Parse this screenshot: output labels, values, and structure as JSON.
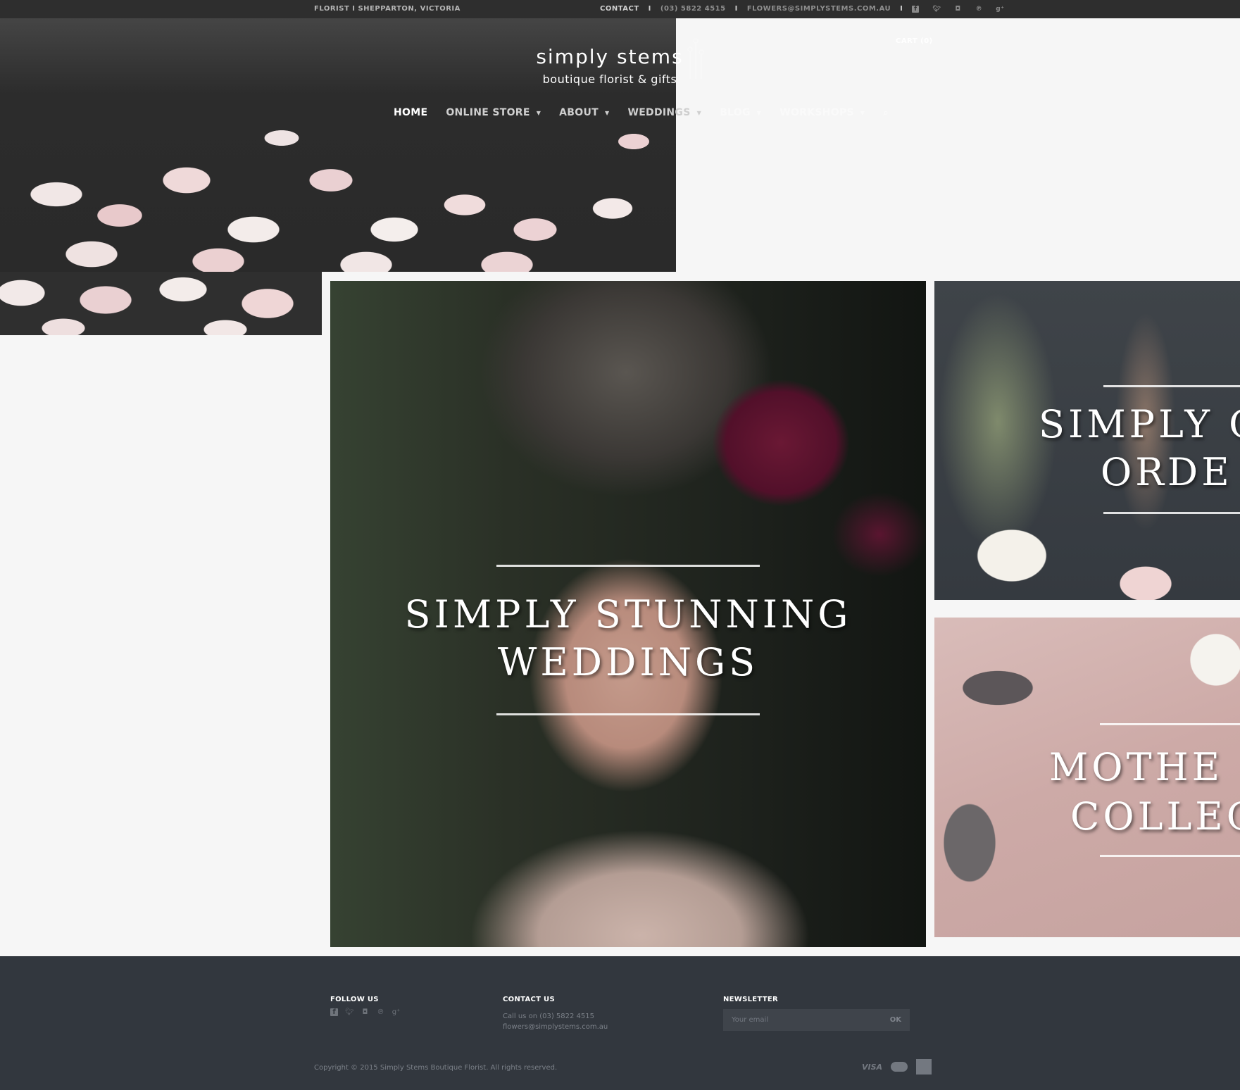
{
  "topbar": {
    "location": "FLORIST I SHEPPARTON, VICTORIA",
    "contact_label": "CONTACT",
    "separator": "I",
    "phone": "(03) 5822 4515",
    "email": "FLOWERS@SIMPLYSTEMS.COM.AU",
    "social_icons": [
      "facebook-icon",
      "twitter-icon",
      "instagram-icon",
      "pinterest-icon",
      "google-plus-icon"
    ]
  },
  "header": {
    "logo_name": "simply stems",
    "logo_tagline": "boutique florist & gifts",
    "cart_label": "CART (0)"
  },
  "nav": {
    "items": [
      {
        "label": "HOME",
        "active": true,
        "dropdown": false
      },
      {
        "label": "ONLINE STORE",
        "active": false,
        "dropdown": true
      },
      {
        "label": "ABOUT",
        "active": false,
        "dropdown": true
      },
      {
        "label": "WEDDINGS",
        "active": false,
        "dropdown": true
      },
      {
        "label": "BLOG",
        "active": false,
        "dropdown": true
      },
      {
        "label": "WORKSHOPS",
        "active": false,
        "dropdown": true
      }
    ],
    "caret": "▼",
    "search_icon": "⌕"
  },
  "promos": {
    "weddings": {
      "line1": "SIMPLY STUNNING",
      "line2": "WEDDINGS"
    },
    "order": {
      "line1": "SIMPLY O",
      "line2": "ORDE"
    },
    "mothers": {
      "line1": "MOTHE",
      "line2": "COLLEC"
    }
  },
  "footer": {
    "follow_heading": "FOLLOW US",
    "contact_heading": "CONTACT US",
    "contact_phone_line": "Call us on (03) 5822 4515",
    "contact_email_line": "flowers@simplystems.com.au",
    "newsletter_heading": "NEWSLETTER",
    "newsletter_placeholder": "Your email",
    "newsletter_value": "",
    "newsletter_button": "OK",
    "copyright": "Copyright © 2015 Simply Stems Boutique Florist. All rights reserved.",
    "payment_methods": [
      "VISA",
      "MasterCard",
      "American Express"
    ],
    "visa_label": "VISA"
  },
  "colors": {
    "topbar_bg": "#2e2e2e",
    "page_bg": "#f6f6f6",
    "footer_bg": "#32373e",
    "newsletter_box": "#3f444b"
  }
}
